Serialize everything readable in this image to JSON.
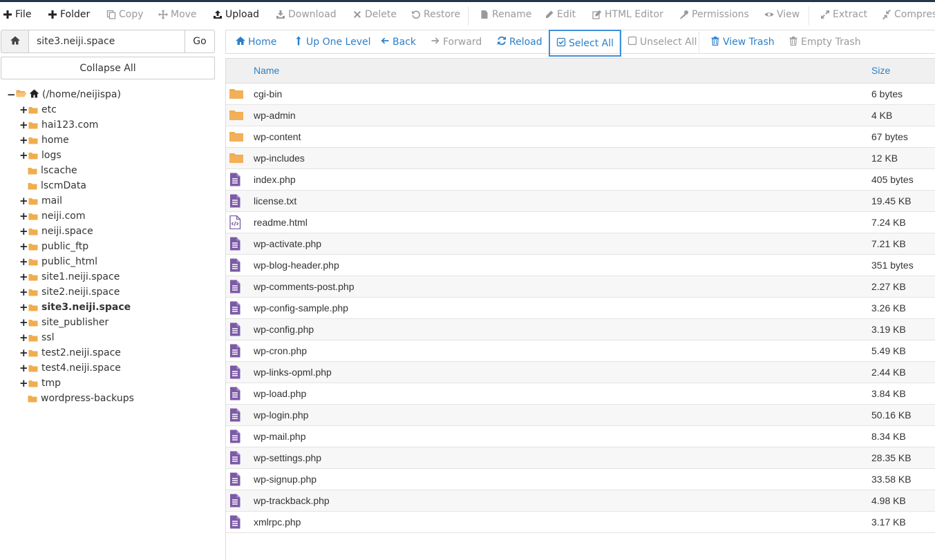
{
  "toolbar": {
    "items": [
      {
        "label": "File",
        "icon": "plus-icon",
        "enabled": true
      },
      {
        "label": "Folder",
        "icon": "plus-icon",
        "enabled": true
      },
      {
        "label": "Copy",
        "icon": "copy-icon",
        "enabled": false
      },
      {
        "label": "Move",
        "icon": "move-icon",
        "enabled": false
      },
      {
        "label": "Upload",
        "icon": "upload-icon",
        "enabled": true
      },
      {
        "label": "Download",
        "icon": "download-icon",
        "enabled": false
      },
      {
        "label": "Delete",
        "icon": "times-icon",
        "enabled": false
      },
      {
        "label": "Restore",
        "icon": "restore-icon",
        "enabled": false
      },
      {
        "label": "Rename",
        "icon": "file-icon",
        "enabled": false
      },
      {
        "label": "Edit",
        "icon": "pencil-icon",
        "enabled": false
      },
      {
        "label": "HTML Editor",
        "icon": "edit-icon",
        "enabled": false
      },
      {
        "label": "Permissions",
        "icon": "key-icon",
        "enabled": false
      },
      {
        "label": "View",
        "icon": "eye-icon",
        "enabled": false
      },
      {
        "label": "Extract",
        "icon": "expand-icon",
        "enabled": false
      },
      {
        "label": "Compres",
        "icon": "compress-icon",
        "enabled": false
      }
    ]
  },
  "sidebar": {
    "path_value": "site3.neiji.space",
    "go_label": "Go",
    "collapse_label": "Collapse All",
    "root_label": "(/home/neijispa)",
    "tree": [
      {
        "label": "etc",
        "expandable": true
      },
      {
        "label": "hai123.com",
        "expandable": true
      },
      {
        "label": "home",
        "expandable": true
      },
      {
        "label": "logs",
        "expandable": true
      },
      {
        "label": "lscache",
        "expandable": false
      },
      {
        "label": "lscmData",
        "expandable": false
      },
      {
        "label": "mail",
        "expandable": true
      },
      {
        "label": "neiji.com",
        "expandable": true
      },
      {
        "label": "neiji.space",
        "expandable": true
      },
      {
        "label": "public_ftp",
        "expandable": true
      },
      {
        "label": "public_html",
        "expandable": true
      },
      {
        "label": "site1.neiji.space",
        "expandable": true
      },
      {
        "label": "site2.neiji.space",
        "expandable": true
      },
      {
        "label": "site3.neiji.space",
        "expandable": true,
        "active": true
      },
      {
        "label": "site_publisher",
        "expandable": true
      },
      {
        "label": "ssl",
        "expandable": true
      },
      {
        "label": "test2.neiji.space",
        "expandable": true
      },
      {
        "label": "test4.neiji.space",
        "expandable": true
      },
      {
        "label": "tmp",
        "expandable": true
      },
      {
        "label": "wordpress-backups",
        "expandable": false
      }
    ]
  },
  "actionbar": {
    "items": [
      {
        "label": "Home",
        "icon": "home-icon",
        "enabled": true
      },
      {
        "label": "Up One Level",
        "icon": "level-up-icon",
        "enabled": true
      },
      {
        "label": "Back",
        "icon": "arrow-left-icon",
        "enabled": true
      },
      {
        "label": "Forward",
        "icon": "arrow-right-icon",
        "enabled": false
      },
      {
        "label": "Reload",
        "icon": "refresh-icon",
        "enabled": true
      },
      {
        "label": "Select All",
        "icon": "check-square-icon",
        "enabled": true,
        "focused": true
      },
      {
        "label": "Unselect All",
        "icon": "square-icon",
        "enabled": false
      },
      {
        "label": "View Trash",
        "icon": "trash-icon",
        "enabled": true
      },
      {
        "label": "Empty Trash",
        "icon": "trash-icon",
        "enabled": false
      }
    ]
  },
  "table": {
    "columns": {
      "name": "Name",
      "size": "Size"
    },
    "rows": [
      {
        "name": "cgi-bin",
        "size": "6 bytes",
        "type": "folder"
      },
      {
        "name": "wp-admin",
        "size": "4 KB",
        "type": "folder"
      },
      {
        "name": "wp-content",
        "size": "67 bytes",
        "type": "folder"
      },
      {
        "name": "wp-includes",
        "size": "12 KB",
        "type": "folder"
      },
      {
        "name": "index.php",
        "size": "405 bytes",
        "type": "text"
      },
      {
        "name": "license.txt",
        "size": "19.45 KB",
        "type": "text"
      },
      {
        "name": "readme.html",
        "size": "7.24 KB",
        "type": "code"
      },
      {
        "name": "wp-activate.php",
        "size": "7.21 KB",
        "type": "text"
      },
      {
        "name": "wp-blog-header.php",
        "size": "351 bytes",
        "type": "text"
      },
      {
        "name": "wp-comments-post.php",
        "size": "2.27 KB",
        "type": "text"
      },
      {
        "name": "wp-config-sample.php",
        "size": "3.26 KB",
        "type": "text"
      },
      {
        "name": "wp-config.php",
        "size": "3.19 KB",
        "type": "text"
      },
      {
        "name": "wp-cron.php",
        "size": "5.49 KB",
        "type": "text"
      },
      {
        "name": "wp-links-opml.php",
        "size": "2.44 KB",
        "type": "text"
      },
      {
        "name": "wp-load.php",
        "size": "3.84 KB",
        "type": "text"
      },
      {
        "name": "wp-login.php",
        "size": "50.16 KB",
        "type": "text"
      },
      {
        "name": "wp-mail.php",
        "size": "8.34 KB",
        "type": "text"
      },
      {
        "name": "wp-settings.php",
        "size": "28.35 KB",
        "type": "text"
      },
      {
        "name": "wp-signup.php",
        "size": "33.58 KB",
        "type": "text"
      },
      {
        "name": "wp-trackback.php",
        "size": "4.98 KB",
        "type": "text"
      },
      {
        "name": "xmlrpc.php",
        "size": "3.17 KB",
        "type": "text"
      }
    ]
  },
  "colors": {
    "accent": "#2a7fc9",
    "folder": "#f0ad4e",
    "file": "#7b5aa6",
    "topbar_border": "#26364a"
  }
}
